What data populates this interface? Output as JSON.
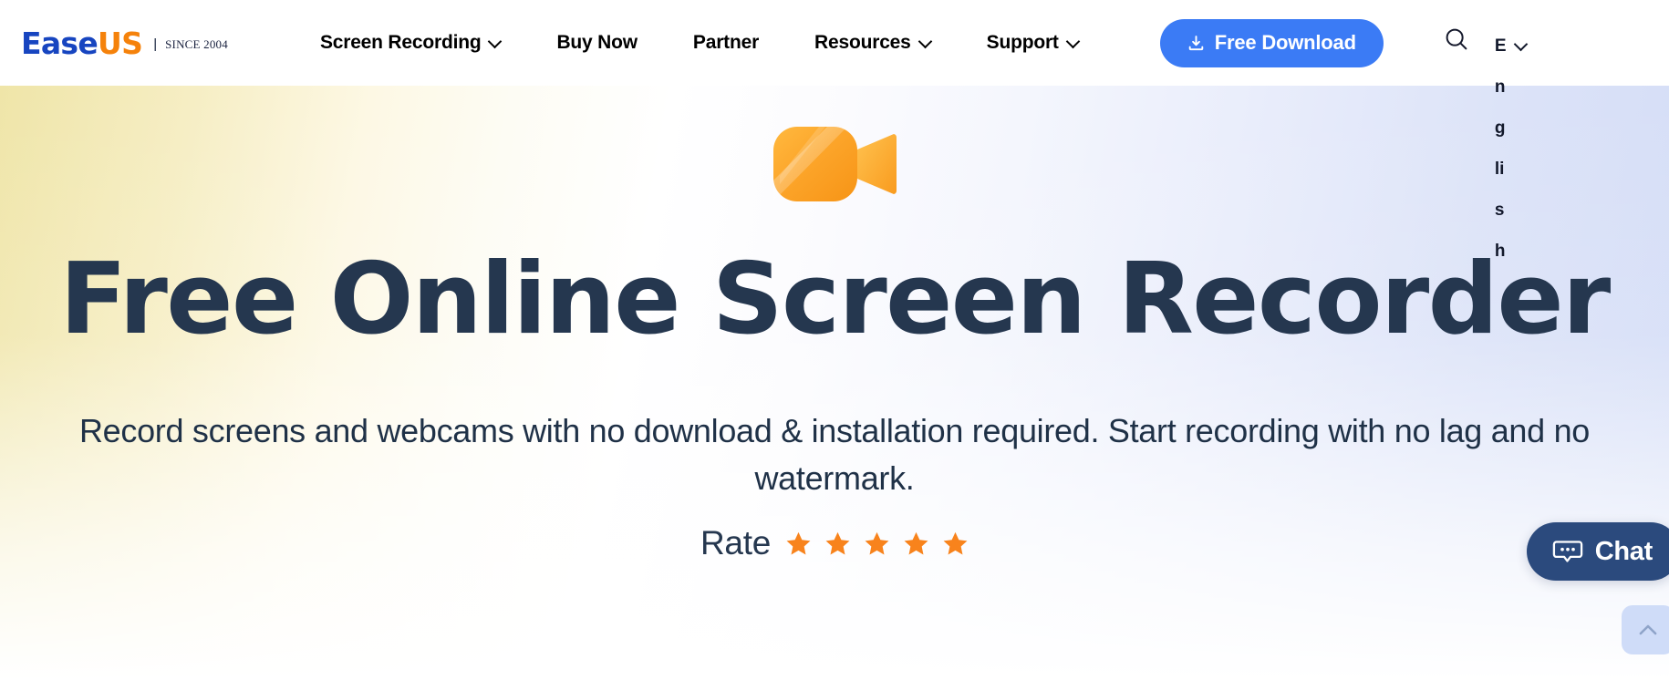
{
  "brand": {
    "name_part1": "Ease",
    "name_part2": "US",
    "divider": "|",
    "since": "SINCE 2004"
  },
  "header": {
    "nav": [
      {
        "label": "Screen Recording",
        "has_caret": true
      },
      {
        "label": "Buy Now",
        "has_caret": false
      },
      {
        "label": "Partner",
        "has_caret": false
      },
      {
        "label": "Resources",
        "has_caret": true
      },
      {
        "label": "Support",
        "has_caret": true
      }
    ],
    "download_button": "Free Download",
    "search_icon": "search-icon",
    "language": "English",
    "accent_blue": "#3b7bf5"
  },
  "hero": {
    "product_icon": "video-camera-icon",
    "headline": "Free Online Screen Recorder",
    "subtitle": "Record screens and webcams with no download & installation required. Start recording with no lag and no watermark.",
    "rate_label": "Rate",
    "stars_filled": 5,
    "stars_total": 5,
    "star_color": "#f8831c",
    "heading_color": "#25374f"
  },
  "widgets": {
    "chat_label": "Chat",
    "chat_icon": "chat-bubble-icon",
    "chat_color": "#2b4a7d",
    "scroll_top_icon": "chevron-up-icon"
  }
}
